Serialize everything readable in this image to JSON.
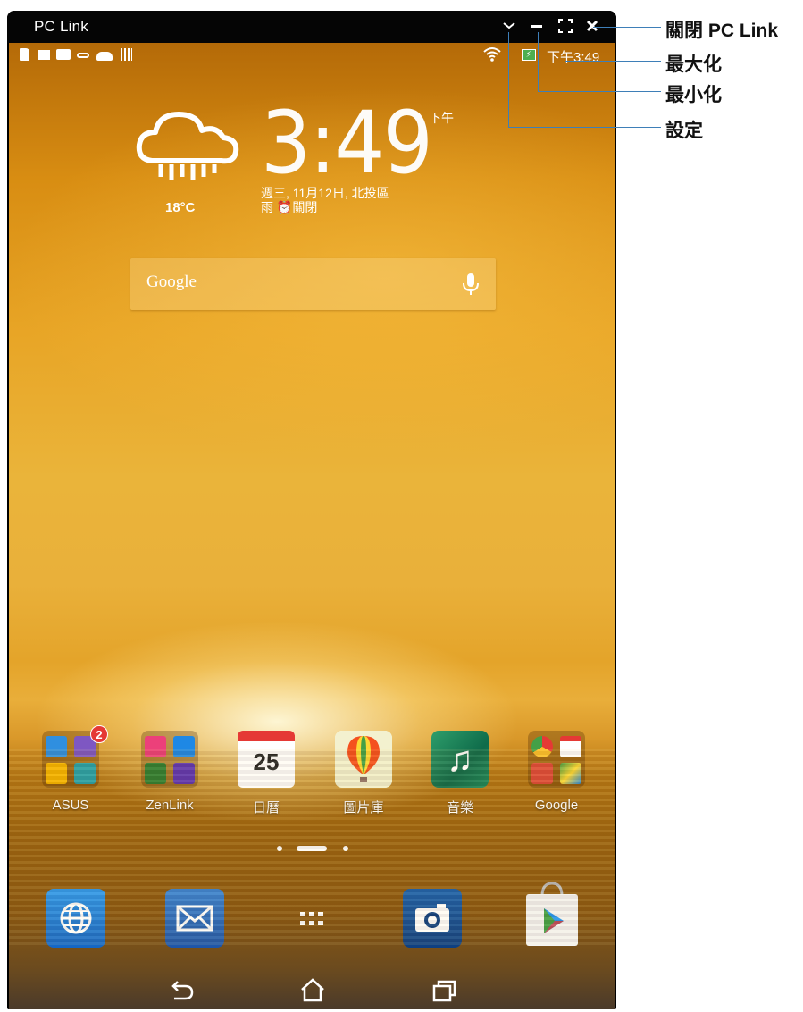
{
  "window": {
    "title": "PC Link",
    "controls": {
      "settings_glyph": "⌄",
      "minimize_glyph": "—",
      "maximize_glyph": "⛶",
      "close_glyph": "✕"
    }
  },
  "statusbar": {
    "time": "下午3:49",
    "battery_glyph": "⚡",
    "wifi_glyph": "≋"
  },
  "clock_widget": {
    "time": "3:49",
    "ampm": "下午",
    "date_line": "週三, 11月12日, 北投區",
    "weather_line": "雨  ⏰關閉",
    "temperature": "18°C"
  },
  "search": {
    "logo": "Google"
  },
  "apps": [
    {
      "label": "ASUS",
      "badge": "2"
    },
    {
      "label": "ZenLink"
    },
    {
      "label": "日曆",
      "day": "25"
    },
    {
      "label": "圖片庫"
    },
    {
      "label": "音樂",
      "note": "♫"
    },
    {
      "label": "Google"
    }
  ],
  "dock": {
    "browser": "⊕",
    "mail": "✉",
    "apps": "▦",
    "camera": "◉",
    "play": "▶"
  },
  "navbar": {
    "back": "↶",
    "home": "⌂",
    "recents": "❐"
  },
  "callouts": {
    "close": "關閉 PC Link",
    "maximize": "最大化",
    "minimize": "最小化",
    "settings": "設定"
  },
  "colors": {
    "callout_line": "#3e7fb8",
    "title_bar": "#050505",
    "badge": "#e53935"
  }
}
